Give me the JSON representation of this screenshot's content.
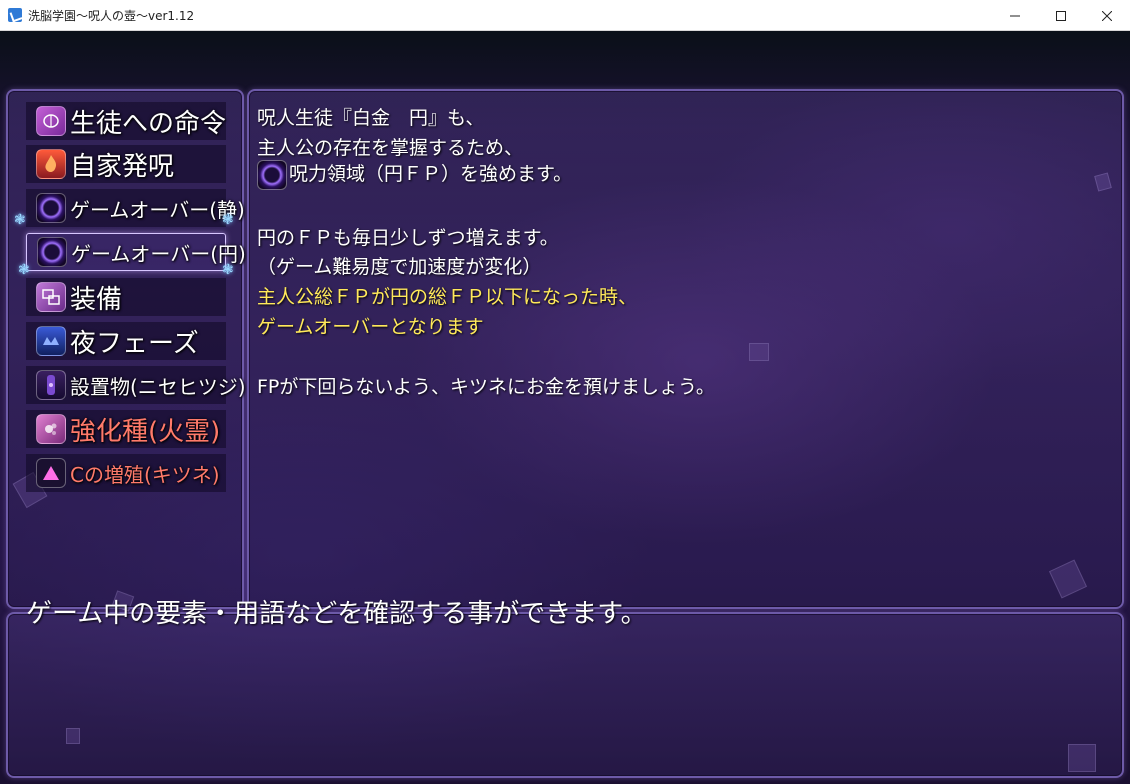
{
  "window": {
    "title": "洗脳学園～呪人の壺～ver1.12"
  },
  "menu": {
    "items": [
      {
        "label": "生徒への命令",
        "icon": "brain-icon"
      },
      {
        "label": "自家発呪",
        "icon": "flame-icon"
      },
      {
        "label": "ゲームオーバー(静)",
        "icon": "curse-orb-icon"
      },
      {
        "label": "ゲームオーバー(円)",
        "icon": "curse-orb-icon"
      },
      {
        "label": "装備",
        "icon": "equipment-icon"
      },
      {
        "label": "夜フェーズ",
        "icon": "night-crest-icon"
      },
      {
        "label": "設置物(ニセヒツジ)",
        "icon": "placed-object-icon"
      },
      {
        "label": "強化種(火霊)",
        "icon": "fire-spirit-icon"
      },
      {
        "label": "Cの増殖(キツネ)",
        "icon": "triangle-icon"
      }
    ],
    "selected_index": 3
  },
  "description": {
    "lines": [
      "呪人生徒『白金　円』も、",
      "主人公の存在を掌握するため、",
      "呪力領域（円ＦＰ）を強めます。",
      "円のＦＰも毎日少しずつ増えます。",
      "（ゲーム難易度で加速度が変化）",
      "主人公総ＦＰが円の総ＦＰ以下になった時、",
      "ゲームオーバーとなります",
      "FPが下回らないよう、キツネにお金を預けましょう。"
    ]
  },
  "help": {
    "text": "ゲーム中の要素・用語などを確認する事ができます。"
  },
  "colors": {
    "highlight_text": "#ffe95a",
    "alert_text": "#ff7a6a",
    "panel_border": "#6d5aa8"
  }
}
